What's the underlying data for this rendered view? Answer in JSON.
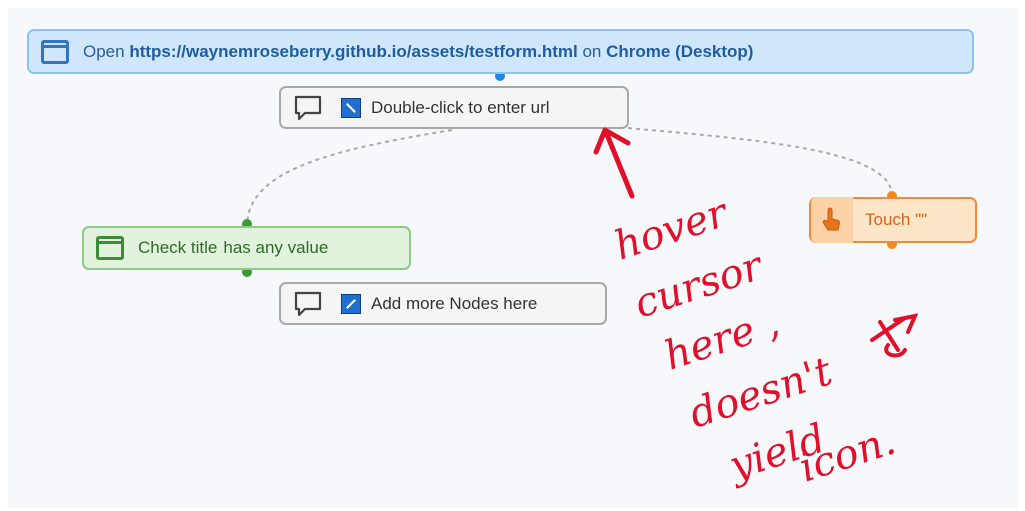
{
  "flow": {
    "open_node": {
      "verb": "Open",
      "url": "https://waynemroseberry.github.io/assets/testform.html",
      "on_word": "on",
      "browser": "Chrome (Desktop)",
      "icon": "browser-window-icon"
    },
    "double_click_node": {
      "text": "Double-click to enter url",
      "icon": "comment-icon"
    },
    "check_node": {
      "text_a": "Check title",
      "text_b": "has any value",
      "icon": "browser-window-icon"
    },
    "add_node": {
      "text": "Add more Nodes here",
      "icon": "comment-icon"
    },
    "touch_node": {
      "text": "Touch \"\"",
      "icon": "touch-hand-icon"
    }
  },
  "annotation": {
    "line1": "hover",
    "line2": "cursor",
    "line3": "here ,",
    "line4": "doesn't",
    "line5": "yield",
    "line6": "icon.",
    "color": "#e0102a"
  },
  "colors": {
    "open_bg": "#cfe6fb",
    "check_bg": "#e2f3dd",
    "touch_bg": "#fde6c8",
    "connector_dot_blue": "#1e88e5",
    "connector_dot_green": "#3a9b35",
    "connector_dot_orange": "#f28a1a"
  }
}
